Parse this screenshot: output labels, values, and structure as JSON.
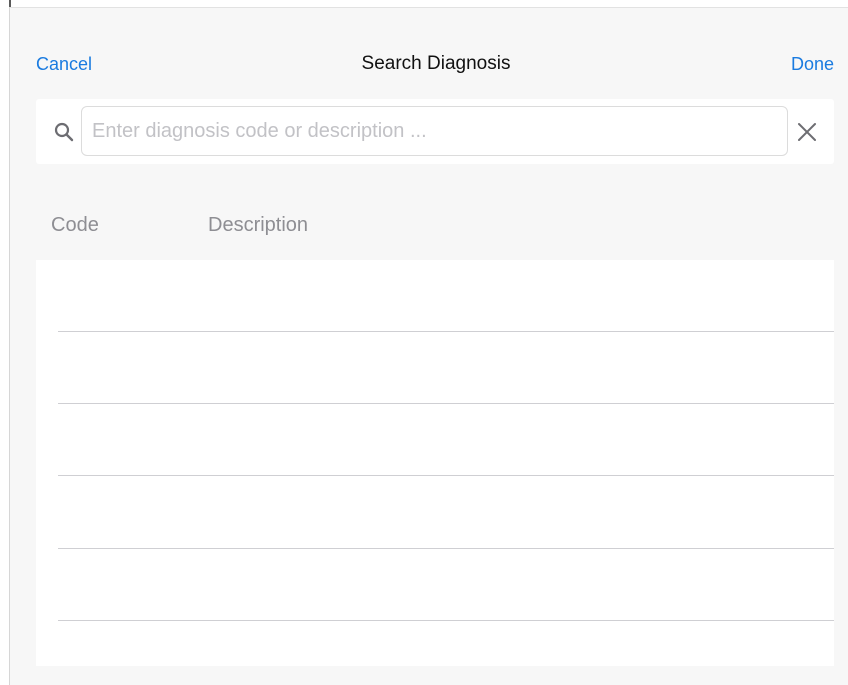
{
  "nav": {
    "cancel_label": "Cancel",
    "title": "Search Diagnosis",
    "done_label": "Done"
  },
  "search": {
    "value": "",
    "placeholder": "Enter diagnosis code or description ...",
    "search_icon": "search-icon",
    "clear_icon": "close-icon"
  },
  "table": {
    "columns": [
      "Code",
      "Description"
    ],
    "rows": [
      {
        "code": "",
        "description": ""
      },
      {
        "code": "",
        "description": ""
      },
      {
        "code": "",
        "description": ""
      },
      {
        "code": "",
        "description": ""
      },
      {
        "code": "",
        "description": ""
      }
    ]
  },
  "colors": {
    "accent": "#1a7be0",
    "background": "#f7f7f7",
    "secondary_text": "#8e8e93",
    "separator": "#cfcfd3"
  }
}
